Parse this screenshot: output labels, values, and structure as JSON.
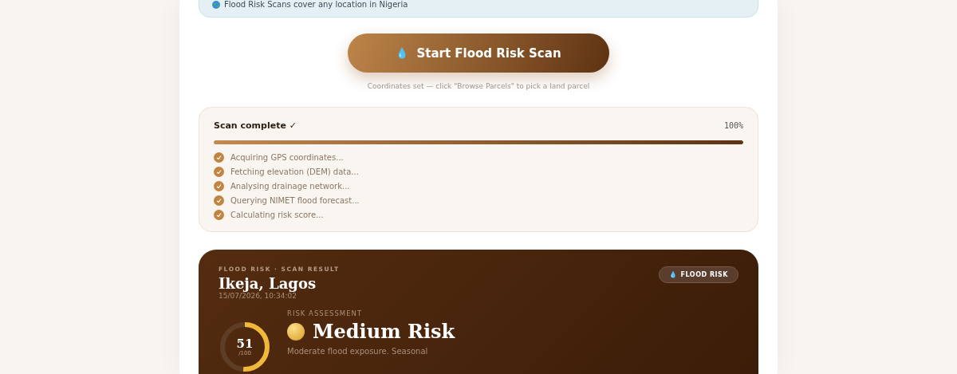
{
  "coverage_note": "Flood Risk Scans cover any location in Nigeria",
  "scan_button": {
    "icon": "💧",
    "label": "Start Flood Risk Scan"
  },
  "hint": "Coordinates set — click \"Browse Parcels\" to pick a land parcel",
  "progress": {
    "title": "Scan complete ✓",
    "percent": "100%",
    "level": 1,
    "steps": [
      {
        "label": "Acquiring GPS coordinates...",
        "done": true
      },
      {
        "label": "Fetching elevation (DEM) data...",
        "done": true
      },
      {
        "label": "Analysing drainage network...",
        "done": true
      },
      {
        "label": "Querying NIMET flood forecast...",
        "done": true
      },
      {
        "label": "Calculating risk score...",
        "done": true
      }
    ]
  },
  "result": {
    "eyebrow": "FLOOD RISK · SCAN RESULT",
    "location": "Ikeja, Lagos",
    "timestamp": "15/07/2026, 10:34:02",
    "badge": {
      "icon": "💧",
      "label": "FLOOD RISK"
    },
    "score": "51",
    "score_max": "/100",
    "level": 0.51,
    "assessment_label": "RISK ASSESSMENT",
    "risk": "Medium Risk",
    "summary": "Moderate flood exposure. Seasonal"
  }
}
